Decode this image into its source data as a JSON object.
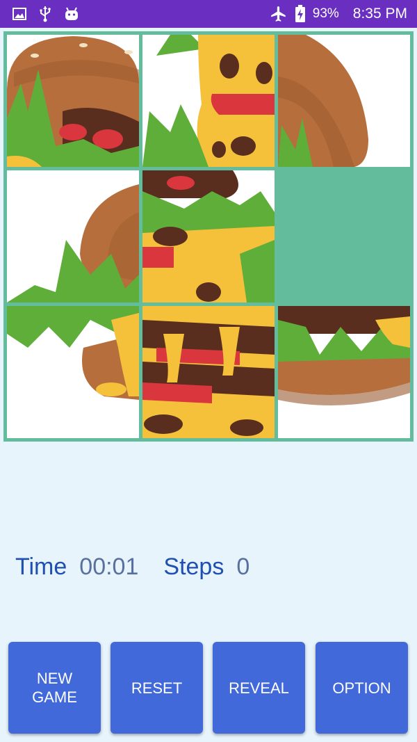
{
  "status_bar": {
    "battery_percent": "93%",
    "time": "8:35 PM",
    "icons": [
      "image-icon",
      "usb-icon",
      "android-icon",
      "airplane-icon",
      "battery-charging-icon"
    ]
  },
  "puzzle": {
    "grid_size": 3,
    "empty_tile_slot": 5,
    "colors": {
      "frame": "#63bc9c",
      "bun": "#b66e3c",
      "lettuce": "#5fae3a",
      "cheese": "#f5c13a",
      "patty": "#5a2e1e",
      "tomato": "#d9363e"
    }
  },
  "stats": {
    "time_label": "Time",
    "time_value": "00:01",
    "steps_label": "Steps",
    "steps_value": "0"
  },
  "buttons": {
    "new_game": "NEW\nGAME",
    "reset": "RESET",
    "reveal": "REVEAL",
    "option": "OPTION"
  }
}
